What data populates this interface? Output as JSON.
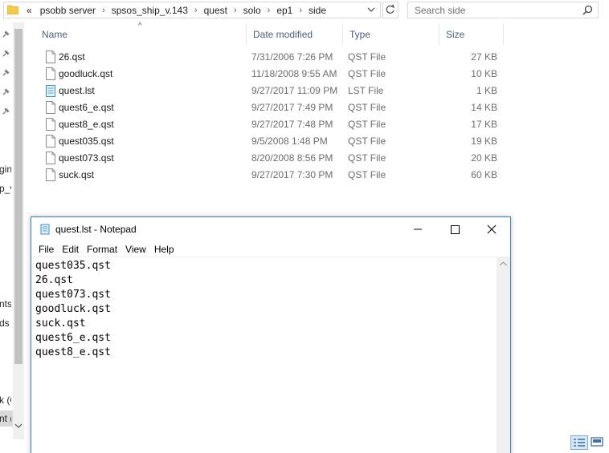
{
  "explorer": {
    "breadcrumbs": [
      "psobb server",
      "spsos_ship_v.143",
      "quest",
      "solo",
      "ep1",
      "side"
    ],
    "overflow_label": "«",
    "search_placeholder": "Search side",
    "columns": {
      "name": "Name",
      "date": "Date modified",
      "type": "Type",
      "size": "Size"
    },
    "files": [
      {
        "name": "26.qst",
        "date": "7/31/2006 7:26 PM",
        "type": "QST File",
        "size": "27 KB",
        "icon": "file-icon"
      },
      {
        "name": "goodluck.qst",
        "date": "11/18/2008 9:55 AM",
        "type": "QST File",
        "size": "10 KB",
        "icon": "file-icon"
      },
      {
        "name": "quest.lst",
        "date": "9/27/2017 11:09 PM",
        "type": "LST File",
        "size": "1 KB",
        "icon": "notepad-file-icon"
      },
      {
        "name": "quest6_e.qst",
        "date": "9/27/2017 7:49 PM",
        "type": "QST File",
        "size": "14 KB",
        "icon": "file-icon"
      },
      {
        "name": "quest8_e.qst",
        "date": "9/27/2017 7:48 PM",
        "type": "QST File",
        "size": "17 KB",
        "icon": "file-icon"
      },
      {
        "name": "quest035.qst",
        "date": "9/5/2008 1:48 PM",
        "type": "QST File",
        "size": "19 KB",
        "icon": "file-icon"
      },
      {
        "name": "quest073.qst",
        "date": "8/20/2008 8:56 PM",
        "type": "QST File",
        "size": "20 KB",
        "icon": "file-icon"
      },
      {
        "name": "suck.qst",
        "date": "9/27/2017 7:30 PM",
        "type": "QST File",
        "size": "60 KB",
        "icon": "file-icon"
      }
    ],
    "nav_fragments": [
      "gin_",
      "p_v",
      "nts",
      "ds",
      "k (C",
      "nt ("
    ]
  },
  "notepad": {
    "title": "quest.lst - Notepad",
    "menu": [
      "File",
      "Edit",
      "Format",
      "View",
      "Help"
    ],
    "lines": [
      "quest035.qst",
      "26.qst",
      "quest073.qst",
      "goodluck.qst",
      "suck.qst",
      "quest6_e.qst",
      "quest8_e.qst"
    ]
  },
  "colors": {
    "header_text": "#4c607a",
    "muted_text": "#6d6d6d",
    "window_border": "#3c7fb1",
    "folder_yellow": "#f5c94a"
  }
}
